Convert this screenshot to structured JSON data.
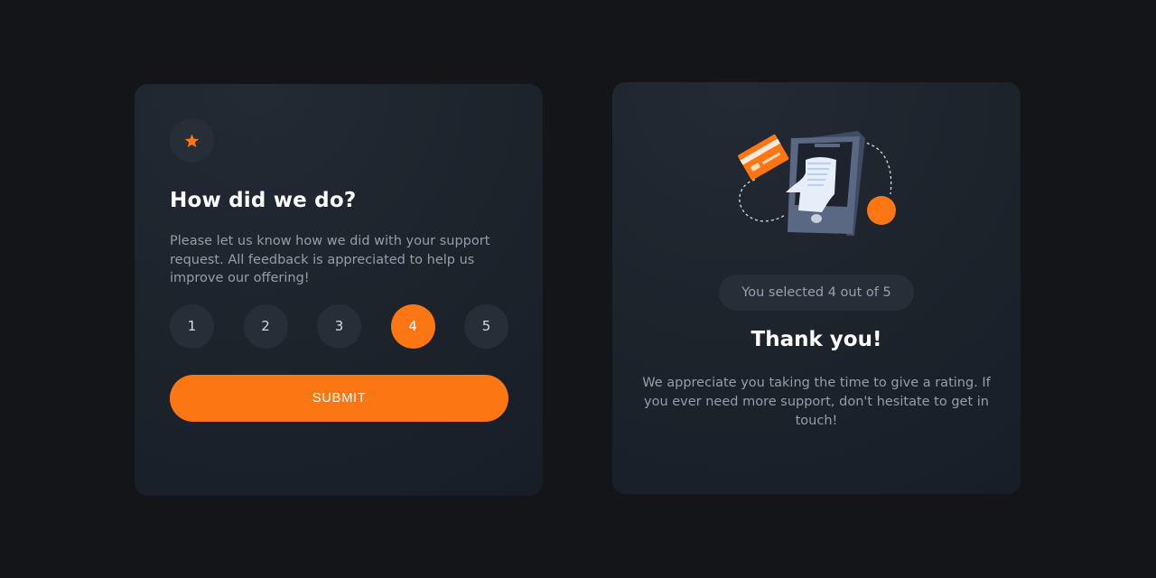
{
  "rating_card": {
    "icon": "star-icon",
    "title": "How did we do?",
    "description": "Please let us know how we did with your support request. All feedback is appreciated to help us improve our offering!",
    "options": [
      "1",
      "2",
      "3",
      "4",
      "5"
    ],
    "selected_value": "4",
    "submit_label": "SUBMIT"
  },
  "thank_you_card": {
    "illustration": "phone-receipt-illustration",
    "selected_text": "You selected 4 out of 5",
    "title": "Thank you!",
    "message": "We appreciate you taking the time to give a rating. If you ever need more support, don't hesitate to get in touch!"
  },
  "colors": {
    "background": "#131518",
    "card": "#1d232b",
    "accent": "#fc7614",
    "muted_circle": "#262e38",
    "text_muted": "#959eac"
  }
}
